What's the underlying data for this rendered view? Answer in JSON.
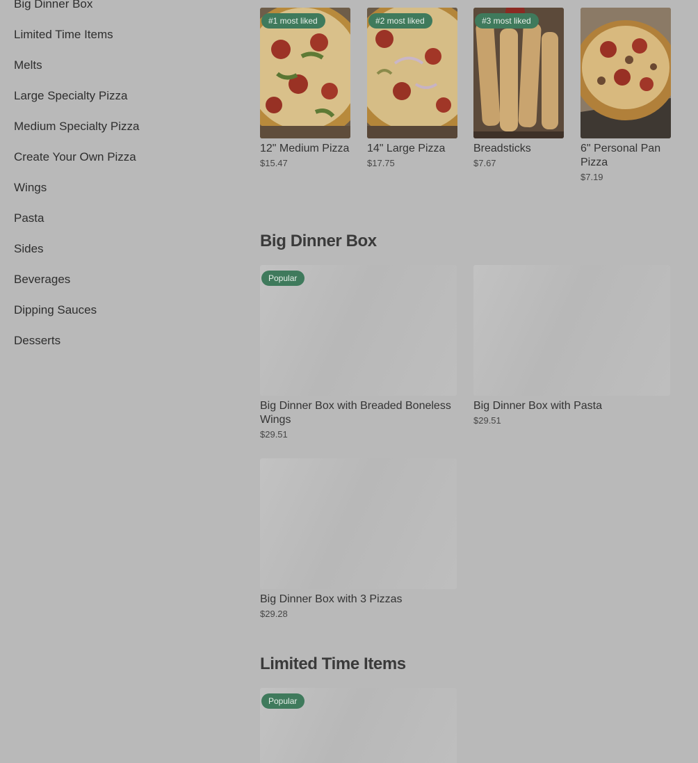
{
  "sidebar": {
    "items": [
      {
        "label": "Big Dinner Box"
      },
      {
        "label": "Limited Time Items"
      },
      {
        "label": "Melts"
      },
      {
        "label": "Large Specialty Pizza"
      },
      {
        "label": "Medium Specialty Pizza"
      },
      {
        "label": "Create Your Own Pizza"
      },
      {
        "label": "Wings"
      },
      {
        "label": "Pasta"
      },
      {
        "label": "Sides"
      },
      {
        "label": "Beverages"
      },
      {
        "label": "Dipping Sauces"
      },
      {
        "label": "Desserts"
      }
    ]
  },
  "most_liked": [
    {
      "badge": "#1 most liked",
      "name": "12\" Medium Pizza",
      "price": "$15.47"
    },
    {
      "badge": "#2 most liked",
      "name": "14\" Large Pizza",
      "price": "$17.75"
    },
    {
      "badge": "#3 most liked",
      "name": "Breadsticks",
      "price": "$7.67"
    },
    {
      "badge": "",
      "name": "6\" Personal Pan Pizza",
      "price": "$7.19"
    }
  ],
  "big_dinner_box": {
    "title": "Big Dinner Box",
    "items": [
      {
        "badge": "Popular",
        "name": "Big Dinner Box with Breaded Boneless Wings",
        "price": "$29.51"
      },
      {
        "badge": "",
        "name": "Big Dinner Box with Pasta",
        "price": "$29.51"
      },
      {
        "badge": "",
        "name": "Big Dinner Box with 3 Pizzas",
        "price": "$29.28"
      }
    ]
  },
  "limited_time": {
    "title": "Limited Time Items",
    "items": [
      {
        "badge": "Popular"
      }
    ]
  },
  "colors": {
    "overlay_background": "#b9b9b9",
    "badge_green": "#3f7a5c"
  }
}
